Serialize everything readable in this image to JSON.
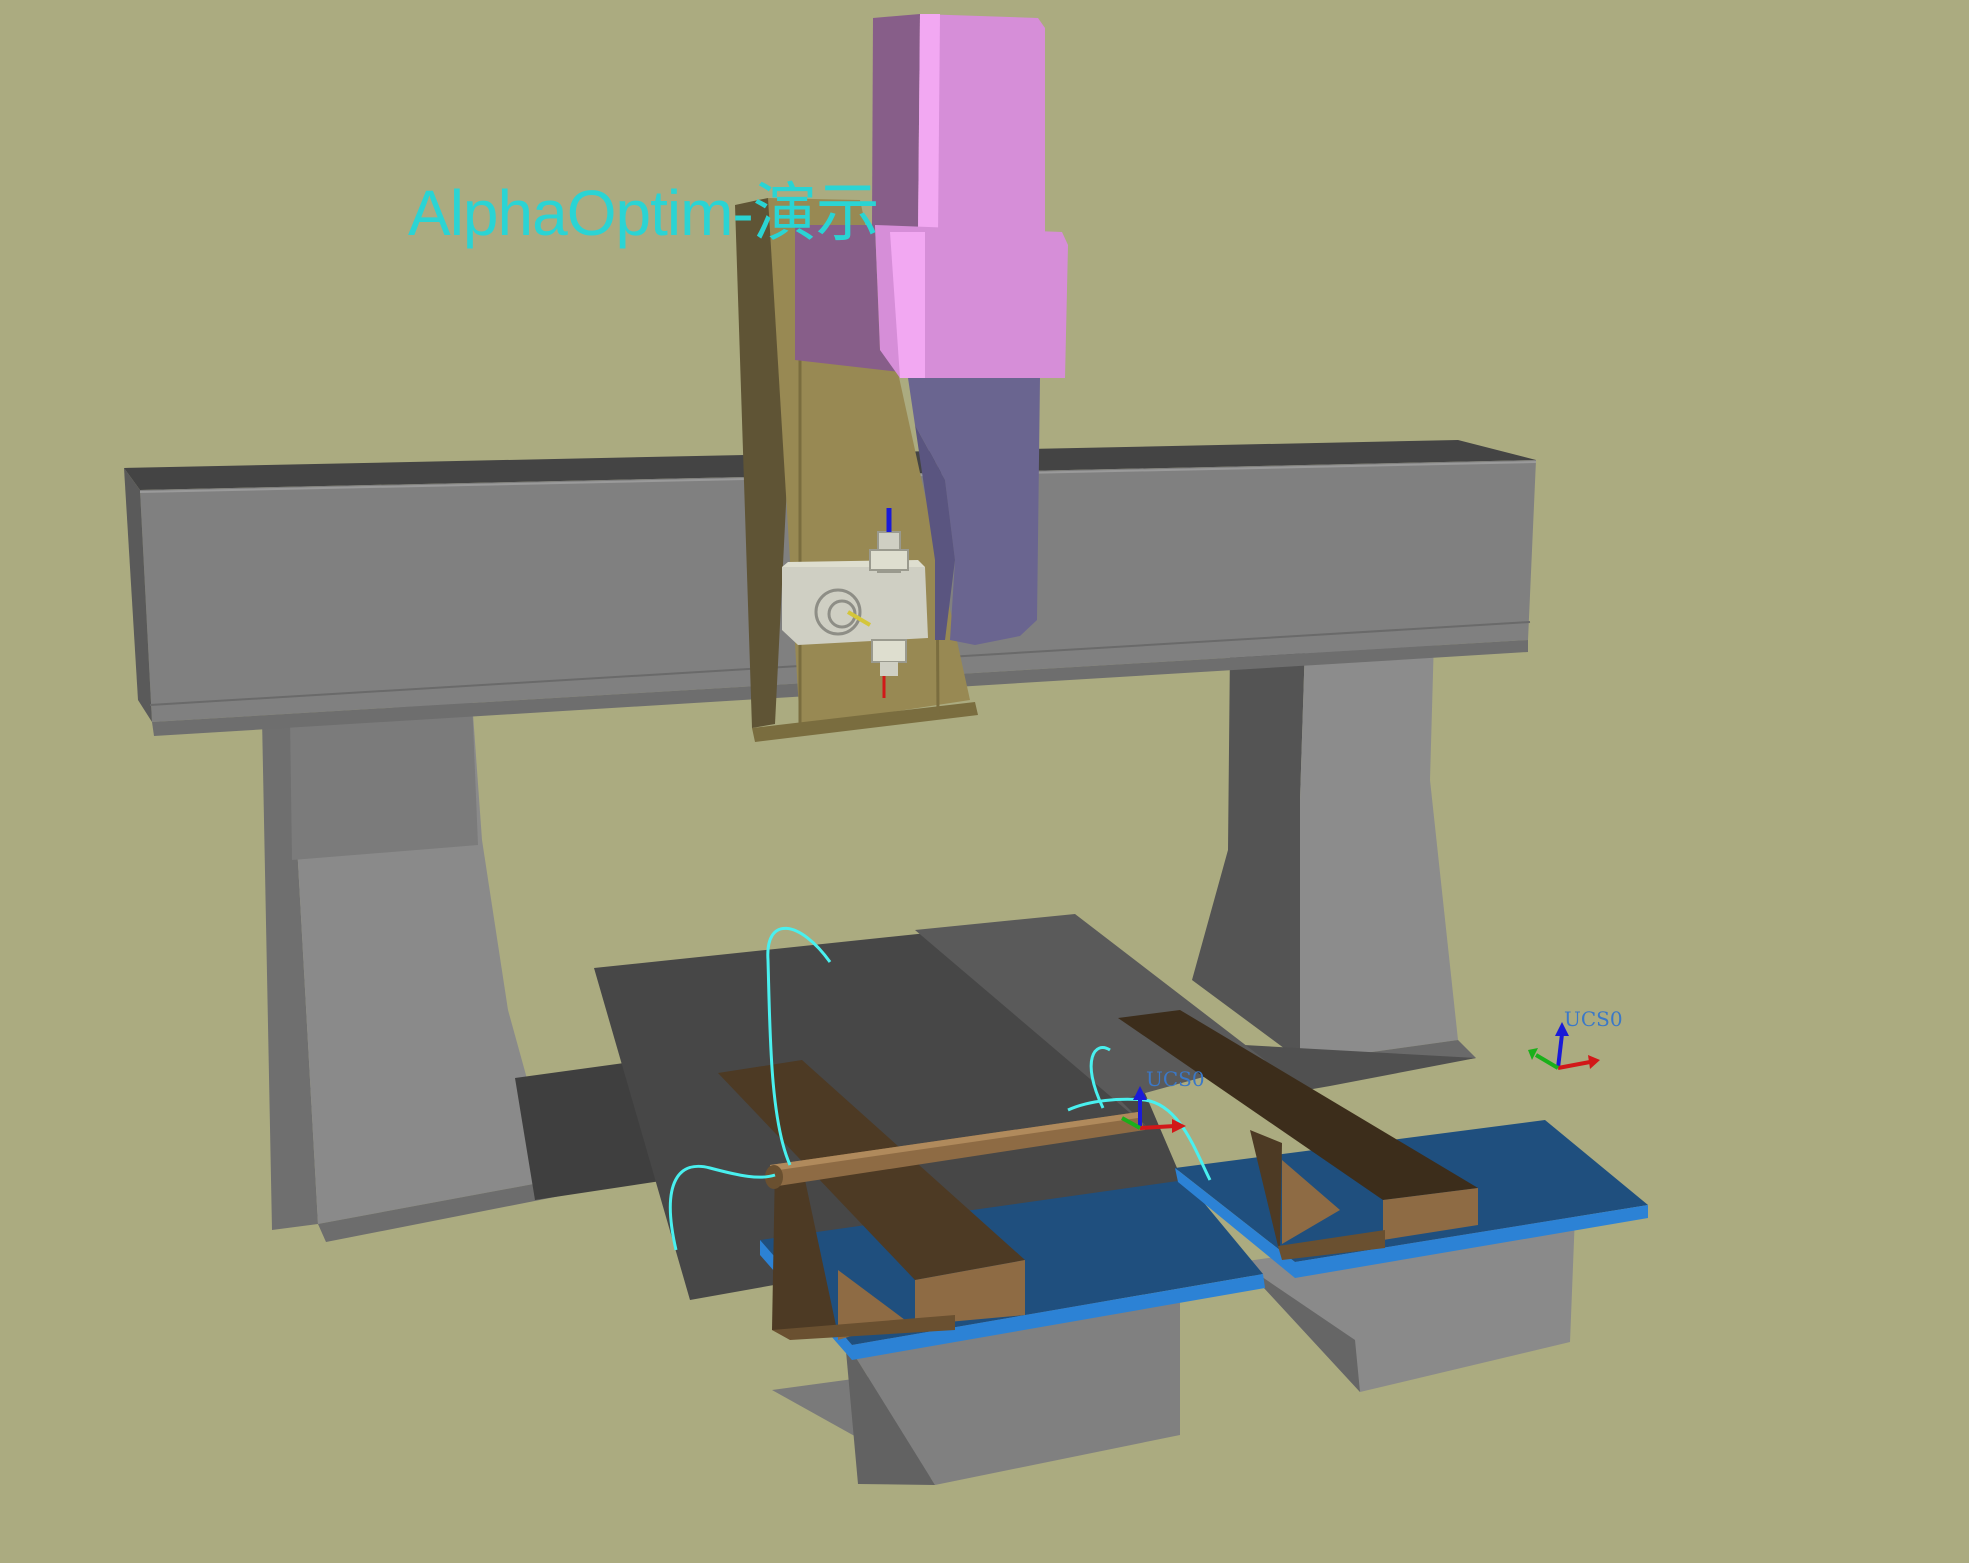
{
  "viewport": {
    "background": "#abab80",
    "watermark_text": "AlphaOptim-演示",
    "watermark_color": "#2ad4d4",
    "toolpath_color": "#49f0ef"
  },
  "ucs": {
    "world_label": "UCS0",
    "part_label": "UCS0",
    "label_color": "#3a78c8",
    "axis_colors": {
      "x": "#d21818",
      "y": "#1ab01a",
      "z": "#1a1ad8"
    }
  },
  "machine": {
    "gantry_color": "#7f7f7f",
    "carriage_color": "#988953",
    "head_color": "#f2a2f2",
    "arm_color": "#6a6590",
    "spindle_color": "#cfcfc3",
    "fixture_color": "#4d3a24",
    "table_color": "#1f4f7e",
    "table_edge_color": "#2c82d5",
    "workpiece_color": "#8e6b44"
  }
}
